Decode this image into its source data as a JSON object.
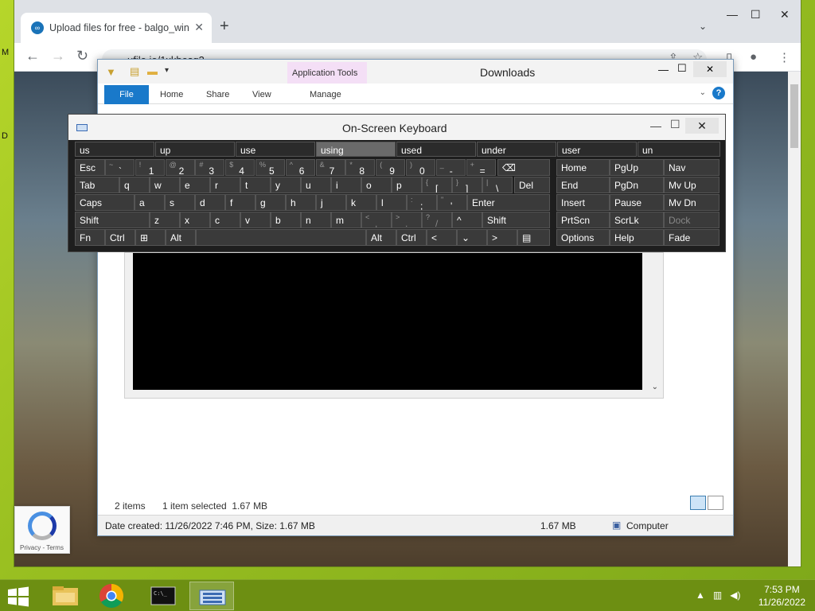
{
  "browser": {
    "tab_title": "Upload files for free - balgo_win",
    "url": "ufile.io/1xkbesq3",
    "new_tab_glyph": "+",
    "tab_close": "✕",
    "minimize": "—",
    "maximize": "☐",
    "close": "✕"
  },
  "explorer": {
    "title": "Downloads",
    "app_tools": "Application Tools",
    "tabs": [
      "File",
      "Home",
      "Share",
      "View"
    ],
    "manage": "Manage",
    "status_items": "2 items",
    "status_selected": "1 item selected  1.67 MB",
    "details_left": "Date created: 11/26/2022 7:46 PM, Size: 1.67 MB",
    "details_size": "1.67 MB",
    "details_location": "Computer"
  },
  "recaptcha": {
    "footer": "Privacy - Terms"
  },
  "osk": {
    "title": "On-Screen Keyboard",
    "predictions": [
      "us",
      "up",
      "use",
      "using",
      "used",
      "under",
      "user",
      "un"
    ],
    "highlighted_prediction": "using",
    "keys": {
      "esc": "Esc",
      "tab": "Tab",
      "caps": "Caps",
      "shift": "Shift",
      "fn": "Fn",
      "ctrl": "Ctrl",
      "alt": "Alt",
      "enter": "Enter",
      "del": "Del",
      "altr": "Alt",
      "ctrlr": "Ctrl",
      "shiftr": "Shift",
      "home": "Home",
      "pgup": "PgUp",
      "nav": "Nav",
      "end": "End",
      "pgdn": "PgDn",
      "mvup": "Mv Up",
      "insert": "Insert",
      "pause": "Pause",
      "mvdn": "Mv Dn",
      "prtscn": "PrtScn",
      "scrlk": "ScrLk",
      "dock": "Dock",
      "options": "Options",
      "help": "Help",
      "fade": "Fade"
    },
    "row_num": [
      [
        "~",
        "`"
      ],
      [
        "!",
        "1"
      ],
      [
        "@",
        "2"
      ],
      [
        "#",
        "3"
      ],
      [
        "$",
        "4"
      ],
      [
        "%",
        "5"
      ],
      [
        "^",
        "6"
      ],
      [
        "&",
        "7"
      ],
      [
        "*",
        "8"
      ],
      [
        "(",
        "9"
      ],
      [
        ")",
        "0"
      ],
      [
        "_",
        "-"
      ],
      [
        "+",
        "="
      ]
    ],
    "row_q": [
      "q",
      "w",
      "e",
      "r",
      "t",
      "y",
      "u",
      "i",
      "o",
      "p"
    ],
    "row_q_extra": [
      [
        "{",
        "["
      ],
      [
        "}",
        "]"
      ],
      [
        "|",
        "\\"
      ]
    ],
    "row_a": [
      "a",
      "s",
      "d",
      "f",
      "g",
      "h",
      "j",
      "k",
      "l"
    ],
    "row_a_extra": [
      [
        ":",
        ";"
      ],
      [
        "\"",
        "'"
      ]
    ],
    "row_z": [
      "z",
      "x",
      "c",
      "v",
      "b",
      "n",
      "m"
    ],
    "row_z_extra": [
      [
        "<",
        ","
      ],
      [
        ">",
        "."
      ],
      [
        "?",
        "/"
      ]
    ],
    "arrows": {
      "left": "<",
      "down": "⌄",
      "right": ">",
      "up": "^"
    }
  },
  "taskbar": {
    "time": "7:53 PM",
    "date": "11/26/2022"
  }
}
